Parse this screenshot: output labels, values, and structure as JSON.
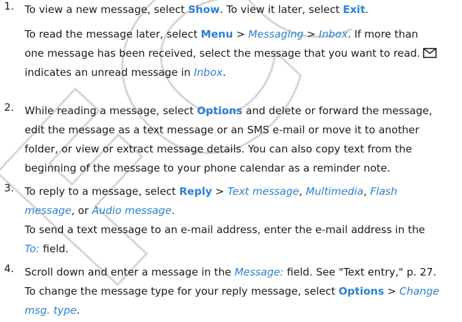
{
  "colors": {
    "accent": "#2b80d3",
    "text": "#1a1a1a",
    "watermark": "#d8d8d8"
  },
  "watermark": {
    "text": "FCC"
  },
  "steps": [
    {
      "number": "1.",
      "p1": [
        {
          "t": "To view a new message, select ",
          "s": ""
        },
        {
          "t": "Show",
          "s": "b"
        },
        {
          "t": ". To view it later, select ",
          "s": ""
        },
        {
          "t": "Exit",
          "s": "b"
        },
        {
          "t": ".",
          "s": ""
        }
      ],
      "p2_line1": [
        {
          "t": "To read the message later, select ",
          "s": ""
        },
        {
          "t": "Menu",
          "s": "b"
        },
        {
          "t": " > ",
          "s": ""
        },
        {
          "t": "Messaging",
          "s": "i"
        },
        {
          "t": " > ",
          "s": ""
        },
        {
          "t": "Inbox",
          "s": "i"
        },
        {
          "t": ". If more than",
          "s": ""
        }
      ],
      "p2_line2": [
        {
          "t": "one message has been received, select the message that you want to read.",
          "s": ""
        }
      ],
      "envelope_icon": "envelope-icon",
      "p2_line3": [
        {
          "t": "indicates an unread message in ",
          "s": ""
        },
        {
          "t": "Inbox",
          "s": "i"
        },
        {
          "t": ".",
          "s": ""
        }
      ]
    },
    {
      "number": "2.",
      "lines": [
        [
          {
            "t": "While reading a message, select ",
            "s": ""
          },
          {
            "t": "Options",
            "s": "b"
          },
          {
            "t": " and delete or forward the message,",
            "s": ""
          }
        ],
        [
          {
            "t": "edit the message as a text message or an SMS e-mail or move it to another",
            "s": ""
          }
        ],
        [
          {
            "t": "folder, or view or extract message details. You can also copy text from the",
            "s": ""
          }
        ],
        [
          {
            "t": "beginning of the message to your phone calendar as a reminder note.",
            "s": ""
          }
        ]
      ]
    },
    {
      "number": "3.",
      "lines": [
        [
          {
            "t": "To reply to a message, select ",
            "s": ""
          },
          {
            "t": "Reply",
            "s": "b"
          },
          {
            "t": " > ",
            "s": ""
          },
          {
            "t": "Text message",
            "s": "i"
          },
          {
            "t": ", ",
            "s": ""
          },
          {
            "t": "Multimedia",
            "s": "i"
          },
          {
            "t": ", ",
            "s": ""
          },
          {
            "t": "Flash",
            "s": "i"
          }
        ],
        [
          {
            "t": "message",
            "s": "i"
          },
          {
            "t": ", or ",
            "s": ""
          },
          {
            "t": "Audio message",
            "s": "i"
          },
          {
            "t": ".",
            "s": ""
          }
        ],
        [
          {
            "t": "To send a text message to an e-mail address, enter the e-mail address in the",
            "s": ""
          }
        ],
        [
          {
            "t": "To:",
            "s": "i"
          },
          {
            "t": " field.",
            "s": ""
          }
        ]
      ]
    },
    {
      "number": "4.",
      "lines": [
        [
          {
            "t": "Scroll down and enter a message in the ",
            "s": ""
          },
          {
            "t": "Message:",
            "s": "i"
          },
          {
            "t": " field. See \"Text entry,\" p. 27.",
            "s": ""
          }
        ],
        [
          {
            "t": "To change the message type for your reply message, select ",
            "s": ""
          },
          {
            "t": "Options",
            "s": "b"
          },
          {
            "t": " > ",
            "s": ""
          },
          {
            "t": "Change",
            "s": "i"
          }
        ],
        [
          {
            "t": "msg. type",
            "s": "i"
          },
          {
            "t": ".",
            "s": ""
          }
        ]
      ]
    }
  ]
}
